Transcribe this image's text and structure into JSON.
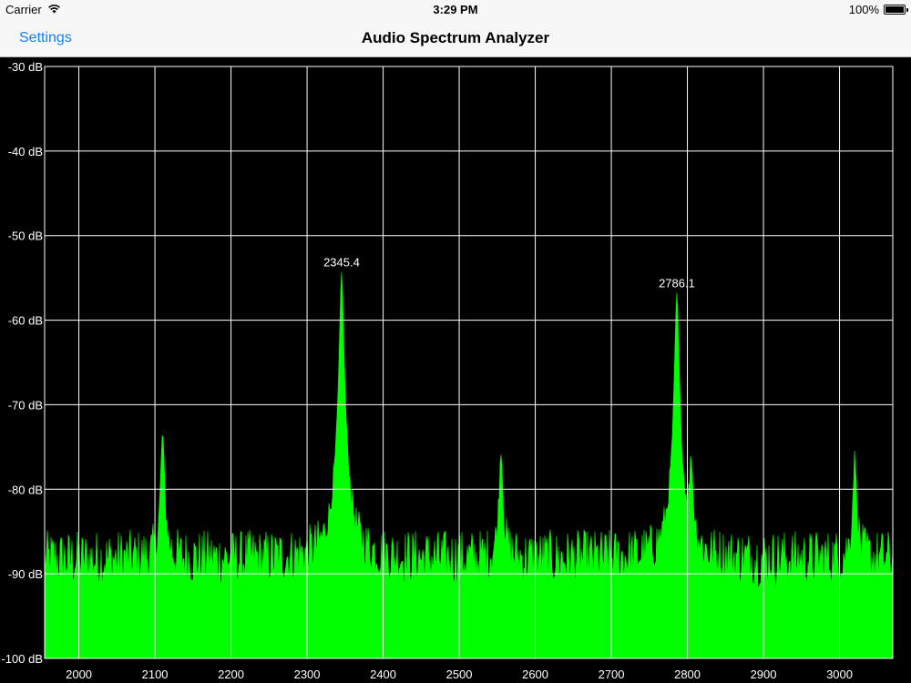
{
  "status_bar": {
    "carrier": "Carrier",
    "time": "3:29 PM",
    "battery": "100%",
    "wifi_icon": "wifi-icon",
    "battery_icon": "battery-icon",
    "battery_level": 1.0
  },
  "nav": {
    "left_button": "Settings",
    "title": "Audio Spectrum Analyzer",
    "accent_color": "#147efb"
  },
  "chart_data": {
    "type": "area",
    "xlim": [
      1955,
      3070
    ],
    "ylim": [
      -100,
      -30
    ],
    "x_ticks": [
      2000,
      2100,
      2200,
      2300,
      2400,
      2500,
      2600,
      2700,
      2800,
      2900,
      3000
    ],
    "x_tick_labels": [
      "2000",
      "2100",
      "2200",
      "2300",
      "2400",
      "2500",
      "2600",
      "2700",
      "2800",
      "2900",
      "3000"
    ],
    "y_ticks": [
      -30,
      -40,
      -50,
      -60,
      -70,
      -80,
      -90,
      -100
    ],
    "y_tick_labels": [
      "-30 dB",
      "-40 dB",
      "-50 dB",
      "-60 dB",
      "-70 dB",
      "-80 dB",
      "-90 dB",
      "-100 dB"
    ],
    "grid": true,
    "fill_color": "#00ff00",
    "noise_floor_db": -88,
    "peaks": [
      {
        "x": 2345.4,
        "y": -54.5,
        "label": "2345.4"
      },
      {
        "x": 2786.1,
        "y": -57.0,
        "label": "2786.1"
      }
    ],
    "minor_peaks": [
      {
        "x": 2110,
        "y": -75
      },
      {
        "x": 2555,
        "y": -77.5
      },
      {
        "x": 2805,
        "y": -80
      },
      {
        "x": 3020,
        "y": -78.5
      }
    ]
  }
}
